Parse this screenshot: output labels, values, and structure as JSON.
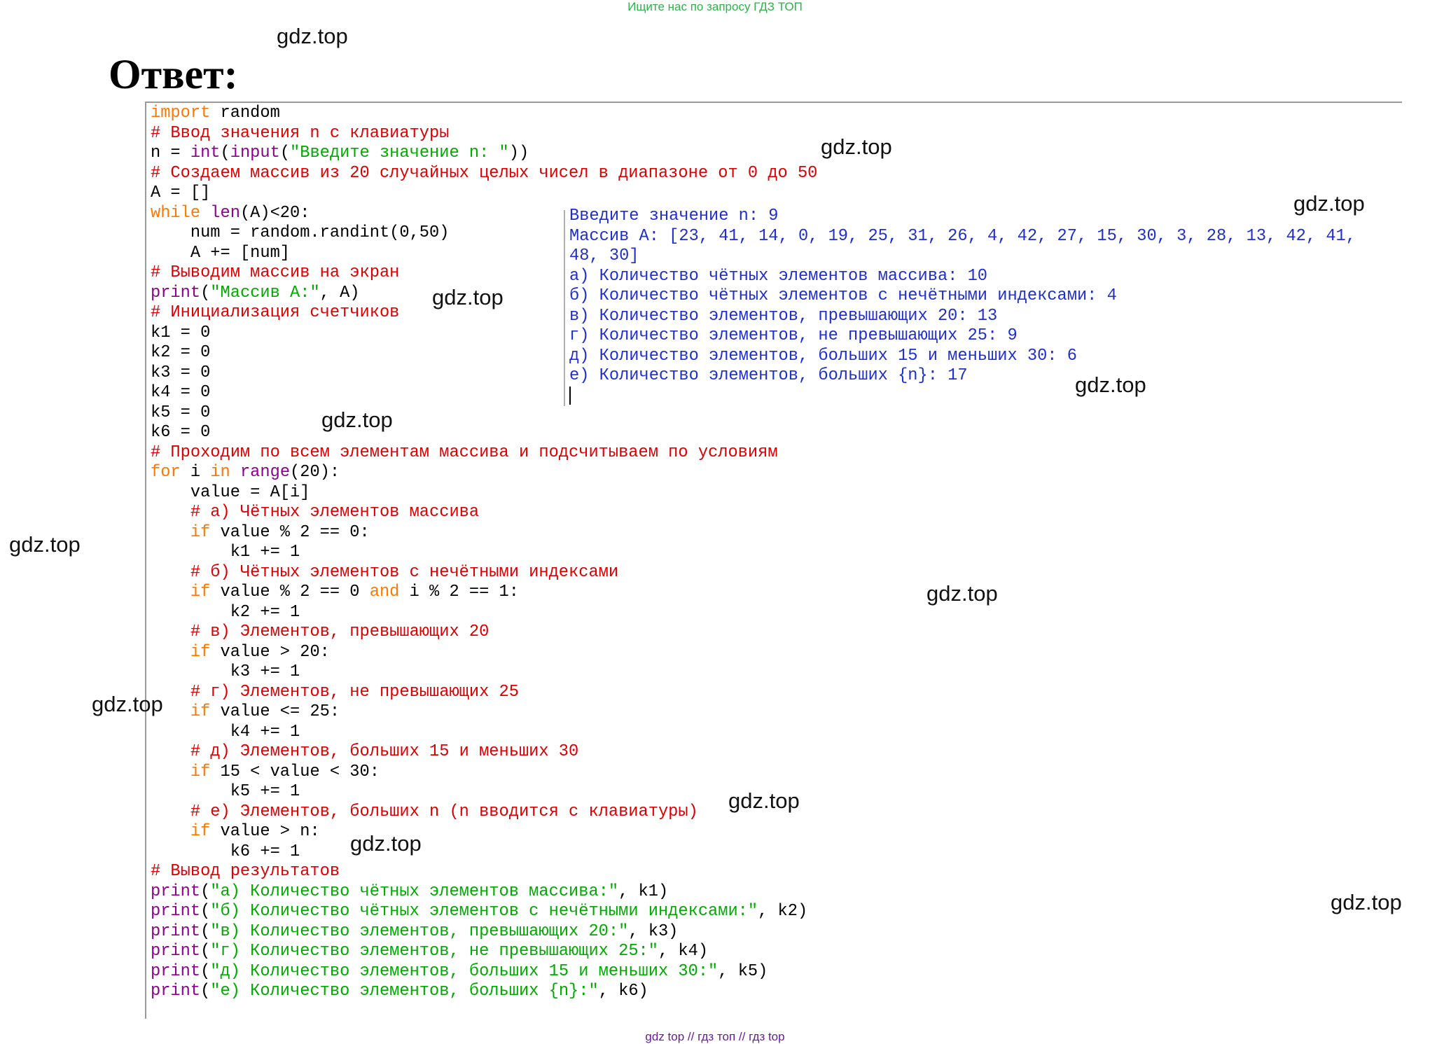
{
  "banner": "Ищите нас по запросу ГДЗ ТОП",
  "heading": "Ответ:",
  "watermark": "gdz.top",
  "code_lines": [
    [
      {
        "c": "kw",
        "t": "import"
      },
      {
        "c": "",
        "t": " random"
      }
    ],
    [
      {
        "c": "cm",
        "t": "# Ввод значения n с клавиатуры"
      }
    ],
    [
      {
        "c": "",
        "t": "n = "
      },
      {
        "c": "bi",
        "t": "int"
      },
      {
        "c": "",
        "t": "("
      },
      {
        "c": "bi",
        "t": "input"
      },
      {
        "c": "",
        "t": "("
      },
      {
        "c": "st",
        "t": "\"Введите значение n: \""
      },
      {
        "c": "",
        "t": "))"
      }
    ],
    [
      {
        "c": "cm",
        "t": "# Создаем массив из 20 случайных целых чисел в диапазоне от 0 до 50"
      }
    ],
    [
      {
        "c": "",
        "t": "A = []"
      }
    ],
    [
      {
        "c": "kw",
        "t": "while"
      },
      {
        "c": "",
        "t": " "
      },
      {
        "c": "bi",
        "t": "len"
      },
      {
        "c": "",
        "t": "(A)<20:"
      }
    ],
    [
      {
        "c": "",
        "t": "    num = random.randint(0,50)"
      }
    ],
    [
      {
        "c": "",
        "t": "    A += [num]"
      }
    ],
    [
      {
        "c": "cm",
        "t": "# Выводим массив на экран"
      }
    ],
    [
      {
        "c": "bi",
        "t": "print"
      },
      {
        "c": "",
        "t": "("
      },
      {
        "c": "st",
        "t": "\"Массив A:\""
      },
      {
        "c": "",
        "t": ", A)"
      }
    ],
    [
      {
        "c": "cm",
        "t": "# Инициализация счетчиков"
      }
    ],
    [
      {
        "c": "",
        "t": "k1 = 0"
      }
    ],
    [
      {
        "c": "",
        "t": "k2 = 0"
      }
    ],
    [
      {
        "c": "",
        "t": "k3 = 0"
      }
    ],
    [
      {
        "c": "",
        "t": "k4 = 0"
      }
    ],
    [
      {
        "c": "",
        "t": "k5 = 0"
      }
    ],
    [
      {
        "c": "",
        "t": "k6 = 0"
      }
    ],
    [
      {
        "c": "cm",
        "t": "# Проходим по всем элементам массива и подсчитываем по условиям"
      }
    ],
    [
      {
        "c": "kw",
        "t": "for"
      },
      {
        "c": "",
        "t": " i "
      },
      {
        "c": "kw",
        "t": "in"
      },
      {
        "c": "",
        "t": " "
      },
      {
        "c": "bi",
        "t": "range"
      },
      {
        "c": "",
        "t": "(20):"
      }
    ],
    [
      {
        "c": "",
        "t": "    value = A[i]"
      }
    ],
    [
      {
        "c": "",
        "t": "    "
      },
      {
        "c": "cm",
        "t": "# а) Чётных элементов массива"
      }
    ],
    [
      {
        "c": "",
        "t": "    "
      },
      {
        "c": "kw",
        "t": "if"
      },
      {
        "c": "",
        "t": " value % 2 == 0:"
      }
    ],
    [
      {
        "c": "",
        "t": "        k1 += 1"
      }
    ],
    [
      {
        "c": "",
        "t": "    "
      },
      {
        "c": "cm",
        "t": "# б) Чётных элементов с нечётными индексами"
      }
    ],
    [
      {
        "c": "",
        "t": "    "
      },
      {
        "c": "kw",
        "t": "if"
      },
      {
        "c": "",
        "t": " value % 2 == 0 "
      },
      {
        "c": "kw",
        "t": "and"
      },
      {
        "c": "",
        "t": " i % 2 == 1:"
      }
    ],
    [
      {
        "c": "",
        "t": "        k2 += 1"
      }
    ],
    [
      {
        "c": "",
        "t": "    "
      },
      {
        "c": "cm",
        "t": "# в) Элементов, превышающих 20"
      }
    ],
    [
      {
        "c": "",
        "t": "    "
      },
      {
        "c": "kw",
        "t": "if"
      },
      {
        "c": "",
        "t": " value > 20:"
      }
    ],
    [
      {
        "c": "",
        "t": "        k3 += 1"
      }
    ],
    [
      {
        "c": "",
        "t": "    "
      },
      {
        "c": "cm",
        "t": "# г) Элементов, не превышающих 25"
      }
    ],
    [
      {
        "c": "",
        "t": "    "
      },
      {
        "c": "kw",
        "t": "if"
      },
      {
        "c": "",
        "t": " value <= 25:"
      }
    ],
    [
      {
        "c": "",
        "t": "        k4 += 1"
      }
    ],
    [
      {
        "c": "",
        "t": "    "
      },
      {
        "c": "cm",
        "t": "# д) Элементов, больших 15 и меньших 30"
      }
    ],
    [
      {
        "c": "",
        "t": "    "
      },
      {
        "c": "kw",
        "t": "if"
      },
      {
        "c": "",
        "t": " 15 < value < 30:"
      }
    ],
    [
      {
        "c": "",
        "t": "        k5 += 1"
      }
    ],
    [
      {
        "c": "",
        "t": "    "
      },
      {
        "c": "cm",
        "t": "# е) Элементов, больших n (n вводится с клавиатуры)"
      }
    ],
    [
      {
        "c": "",
        "t": "    "
      },
      {
        "c": "kw",
        "t": "if"
      },
      {
        "c": "",
        "t": " value > n:"
      }
    ],
    [
      {
        "c": "",
        "t": "        k6 += 1"
      }
    ],
    [
      {
        "c": "cm",
        "t": "# Вывод результатов"
      }
    ],
    [
      {
        "c": "bi",
        "t": "print"
      },
      {
        "c": "",
        "t": "("
      },
      {
        "c": "st",
        "t": "\"а) Количество чётных элементов массива:\""
      },
      {
        "c": "",
        "t": ", k1)"
      }
    ],
    [
      {
        "c": "bi",
        "t": "print"
      },
      {
        "c": "",
        "t": "("
      },
      {
        "c": "st",
        "t": "\"б) Количество чётных элементов с нечётными индексами:\""
      },
      {
        "c": "",
        "t": ", k2)"
      }
    ],
    [
      {
        "c": "bi",
        "t": "print"
      },
      {
        "c": "",
        "t": "("
      },
      {
        "c": "st",
        "t": "\"в) Количество элементов, превышающих 20:\""
      },
      {
        "c": "",
        "t": ", k3)"
      }
    ],
    [
      {
        "c": "bi",
        "t": "print"
      },
      {
        "c": "",
        "t": "("
      },
      {
        "c": "st",
        "t": "\"г) Количество элементов, не превышающих 25:\""
      },
      {
        "c": "",
        "t": ", k4)"
      }
    ],
    [
      {
        "c": "bi",
        "t": "print"
      },
      {
        "c": "",
        "t": "("
      },
      {
        "c": "st",
        "t": "\"д) Количество элементов, больших 15 и меньших 30:\""
      },
      {
        "c": "",
        "t": ", k5)"
      }
    ],
    [
      {
        "c": "bi",
        "t": "print"
      },
      {
        "c": "",
        "t": "("
      },
      {
        "c": "st",
        "t": "\"е) Количество элементов, больших {n}:\""
      },
      {
        "c": "",
        "t": ", k6)"
      }
    ]
  ],
  "output_lines": [
    "Введите значение n: 9",
    "Массив A: [23, 41, 14, 0, 19, 25, 31, 26, 4, 42, 27, 15, 30, 3, 28, 13, 42, 41,",
    "48, 30]",
    "а) Количество чётных элементов массива: 10",
    "б) Количество чётных элементов с нечётными индексами: 4",
    "в) Количество элементов, превышающих 20: 13",
    "г) Количество элементов, не превышающих 25: 9",
    "д) Количество элементов, больших 15 и меньших 30: 6",
    "е) Количество элементов, больших {n}: 17"
  ],
  "footer": "gdz top  //  гдз топ  //  гдз top",
  "colors": {
    "keyword": "#ff7700",
    "comment": "#dd0000",
    "builtin": "#900090",
    "string": "#00aa00",
    "output": "#1f2fcf",
    "banner": "#2db34a",
    "footer": "#6a1b9a"
  }
}
